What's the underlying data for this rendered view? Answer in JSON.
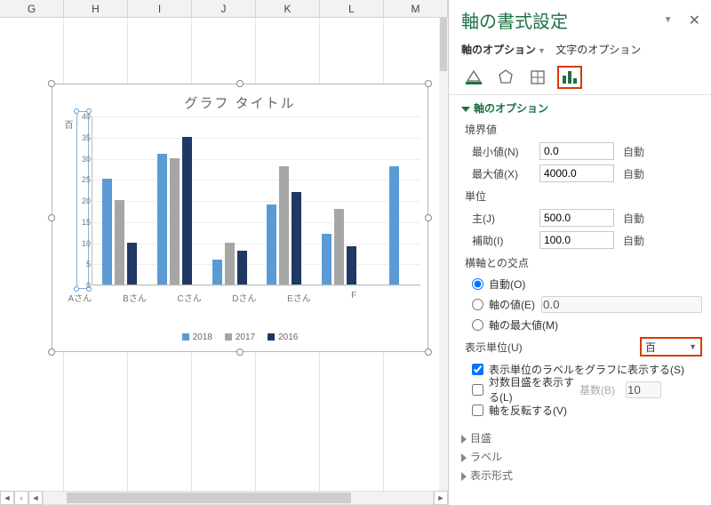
{
  "columns": [
    "G",
    "H",
    "I",
    "J",
    "K",
    "L",
    "M"
  ],
  "chart": {
    "title": "グラフ タイトル",
    "axis_label": "百",
    "categories": [
      "Aさん",
      "Bさん",
      "Cさん",
      "Dさん",
      "Eさん",
      "F"
    ],
    "series_labels": [
      "2018",
      "2017",
      "2016"
    ],
    "y_ticks": [
      "0",
      "5",
      "10",
      "15",
      "20",
      "25",
      "30",
      "35",
      "40"
    ],
    "y_max": 40
  },
  "chart_data": {
    "type": "bar",
    "title": "グラフ タイトル",
    "categories": [
      "Aさん",
      "Bさん",
      "Cさん",
      "Dさん",
      "Eさん",
      "F"
    ],
    "series": [
      {
        "name": "2018",
        "values": [
          25,
          31,
          6,
          19,
          12,
          28
        ]
      },
      {
        "name": "2017",
        "values": [
          20,
          30,
          10,
          28,
          18,
          null
        ]
      },
      {
        "name": "2016",
        "values": [
          10,
          35,
          8,
          22,
          9,
          null
        ]
      }
    ],
    "ylabel": "百",
    "ylim": [
      0,
      40
    ],
    "legend_position": "bottom"
  },
  "pane": {
    "title": "軸の書式設定",
    "tab_axis": "軸のオプション",
    "tab_text": "文字のオプション",
    "section_axis_options": "軸のオプション",
    "bounds_label": "境界値",
    "min_label": "最小値(N)",
    "max_label": "最大値(X)",
    "min_value": "0.0",
    "max_value": "4000.0",
    "units_label": "単位",
    "major_label": "主(J)",
    "minor_label": "補助(I)",
    "major_value": "500.0",
    "minor_value": "100.0",
    "auto": "自動",
    "cross_label": "横軸との交点",
    "cross_auto": "自動(O)",
    "cross_value": "軸の値(E)",
    "cross_value_num": "0.0",
    "cross_max": "軸の最大値(M)",
    "display_units_label": "表示単位(U)",
    "display_units_value": "百",
    "show_unit_label": "表示単位のラベルをグラフに表示する(S)",
    "log_label": "対数目盛を表示する(L)",
    "log_base_label": "基数(B)",
    "log_base_value": "10",
    "reverse_label": "軸を反転する(V)",
    "sect_ticks": "目盛",
    "sect_labels": "ラベル",
    "sect_format": "表示形式"
  }
}
